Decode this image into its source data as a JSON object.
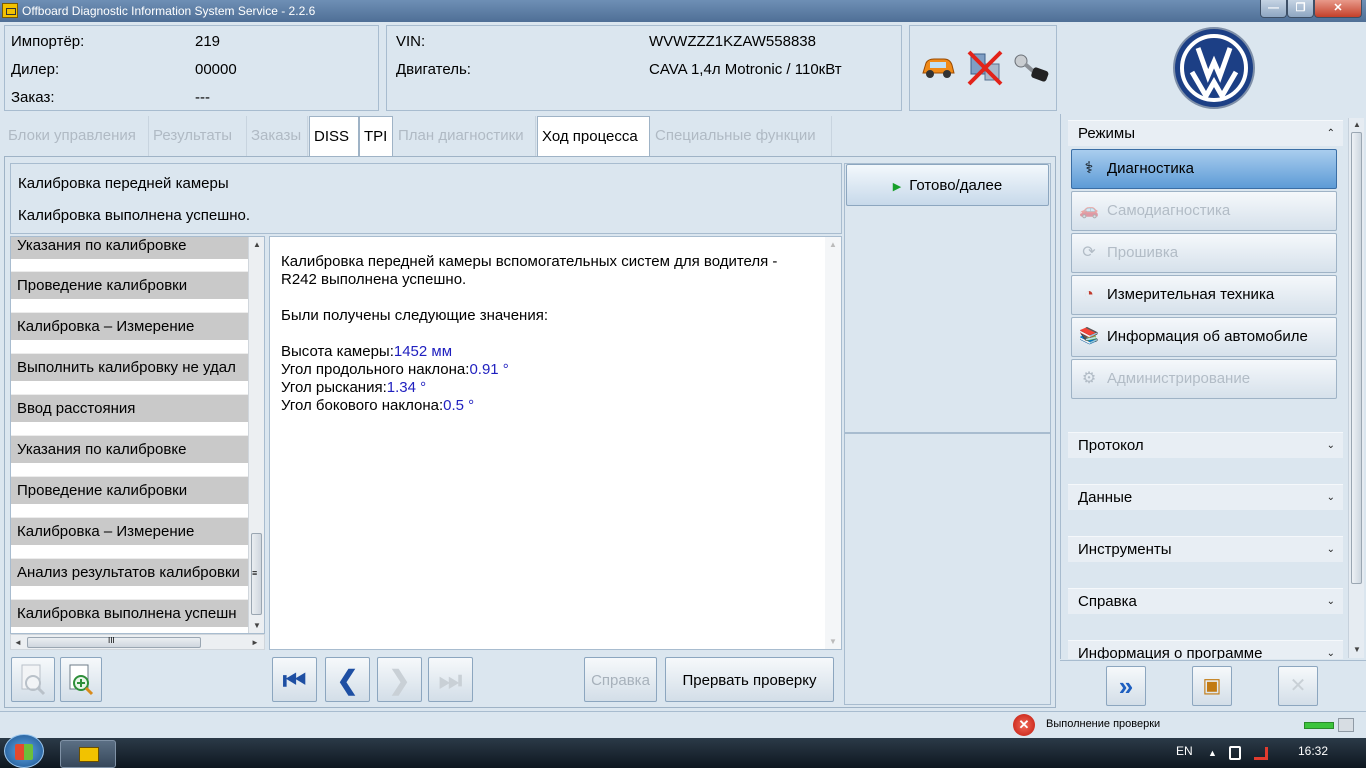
{
  "window": {
    "title": "Offboard Diagnostic Information System Service - 2.2.6",
    "min_glyph": "—",
    "max_glyph": "❐",
    "close_glyph": "✕"
  },
  "header": {
    "importer_label": "Импортёр:",
    "importer_value": "219",
    "dealer_label": "Дилер:",
    "dealer_value": "00000",
    "order_label": "Заказ:",
    "order_value": "---",
    "vin_label": "VIN:",
    "vin_value": "WVWZZZ1KZAW558838",
    "engine_label": "Двигатель:",
    "engine_value": "CAVA 1,4л Motronic / 110кВт",
    "status_icons": [
      "car-icon",
      "connection-disabled-icon",
      "ignition-key-icon"
    ],
    "logo_text": "VW"
  },
  "tabs": [
    {
      "label": "Блоки управления",
      "active": false
    },
    {
      "label": "Результаты",
      "active": false
    },
    {
      "label": "Заказы",
      "active": false
    },
    {
      "label": "DISS",
      "active": true
    },
    {
      "label": "TPI",
      "active": true
    },
    {
      "label": "План диагностики",
      "active": false
    },
    {
      "label": "Ход процесса",
      "active": true
    },
    {
      "label": "Специальные функции",
      "active": false
    }
  ],
  "status": {
    "title": "Калибровка передней камеры",
    "message": "Калибровка выполнена успешно."
  },
  "steps": [
    "Указания по калибровке",
    "Проведение калибровки",
    "Калибровка – Измерение",
    "Выполнить калибровку не удал",
    "Ввод расстояния",
    "Указания по калибровке",
    "Проведение калибровки",
    "Калибровка – Измерение",
    "Анализ результатов калибровки",
    "Калибровка выполнена успешн"
  ],
  "scroll": {
    "up": "▲",
    "down": "▼",
    "left": "◄",
    "right": "►",
    "grip": "≡",
    "hgrip": "III"
  },
  "content": {
    "line1": "Калибровка передней камеры вспомогательных систем для водителя -",
    "line2": "R242 выполнена успешно.",
    "line3": "Были получены следующие значения:",
    "height_label": "Высота камеры:",
    "height_value": "1452 мм",
    "pitch_label": "Угол продольного наклона:",
    "pitch_value": "0.91 °",
    "yaw_label": "Угол рыскания:",
    "yaw_value": "1.34 °",
    "roll_label": "Угол бокового наклона:",
    "roll_value": "0.5 °"
  },
  "actions": {
    "ready_icon": "▶",
    "ready_label": "Готово/далее",
    "help_label": "Справка",
    "abort_label": "Прервать проверку",
    "nav_first": "⏮",
    "nav_prev": "❮",
    "nav_next": "❯",
    "nav_last": "⏭",
    "zoom_out_glyph": "−",
    "zoom_in_glyph": "+"
  },
  "sidebar": {
    "modes_title": "Режимы",
    "modes": [
      {
        "label": "Диагностика",
        "icon": "stethoscope-icon",
        "glyph": "⚕",
        "state": "active"
      },
      {
        "label": "Самодиагностика",
        "icon": "car-self-diagnosis-icon",
        "glyph": "🚗",
        "state": "disabled"
      },
      {
        "label": "Прошивка",
        "icon": "flash-icon",
        "glyph": "⟳",
        "state": "disabled"
      },
      {
        "label": "Измерительная техника",
        "icon": "gauge-icon",
        "glyph": "◔",
        "state": "enabled"
      },
      {
        "label": "Информация об автомобиле",
        "icon": "books-icon",
        "glyph": "📚",
        "state": "enabled"
      },
      {
        "label": "Администрирование",
        "icon": "gear-icon",
        "glyph": "⚙",
        "state": "disabled"
      }
    ],
    "sections": [
      "Протокол",
      "Данные",
      "Инструменты",
      "Справка",
      "Информация о программе"
    ],
    "collapse_glyph": "⌃",
    "expand_glyph": "⌄",
    "bottom_forward": "»",
    "bottom_screen": "▣",
    "bottom_close": "✕"
  },
  "statusbar": {
    "error_glyph": "✕",
    "text": "Выполнение проверки"
  },
  "taskbar": {
    "lang": "EN",
    "tray_up": "▲",
    "time": "16:32"
  }
}
